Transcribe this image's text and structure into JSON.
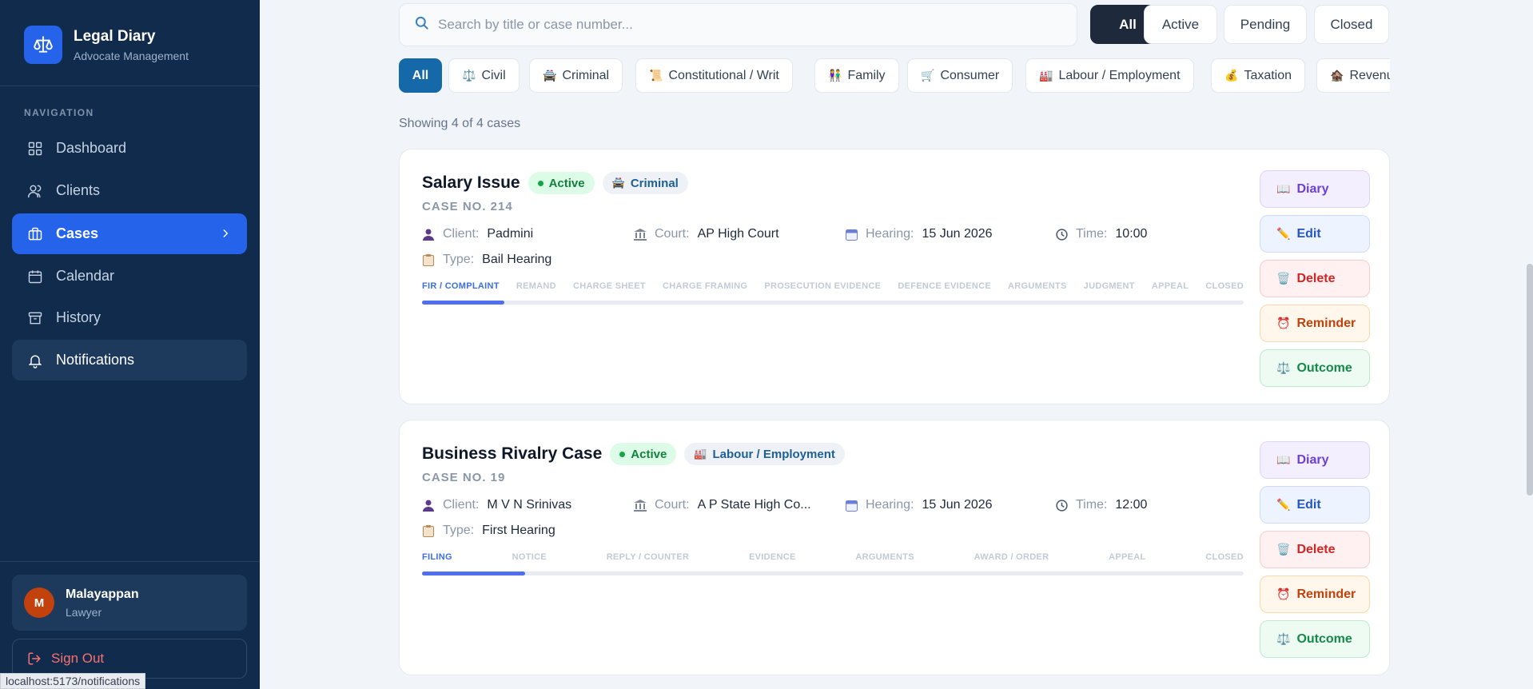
{
  "sidebar": {
    "brand_title": "Legal Diary",
    "brand_subtitle": "Advocate Management",
    "nav_heading": "NAVIGATION",
    "items": [
      {
        "label": "Dashboard",
        "icon": "dashboard-icon"
      },
      {
        "label": "Clients",
        "icon": "users-icon"
      },
      {
        "label": "Cases",
        "icon": "briefcase-icon",
        "active": true
      },
      {
        "label": "Calendar",
        "icon": "calendar-icon"
      },
      {
        "label": "History",
        "icon": "archive-icon"
      },
      {
        "label": "Notifications",
        "icon": "bell-icon",
        "hovered": true
      }
    ],
    "user": {
      "initial": "M",
      "name": "Malayappan",
      "role": "Lawyer"
    },
    "signout_label": "Sign Out",
    "status_url": "localhost:5173/notifications"
  },
  "search": {
    "placeholder": "Search by title or case number..."
  },
  "status_filters": [
    "All",
    "Active",
    "Pending",
    "Closed"
  ],
  "status_filter_selected": "All",
  "categories": [
    {
      "label": "All",
      "emoji": ""
    },
    {
      "label": "Civil",
      "emoji": "⚖️"
    },
    {
      "label": "Criminal",
      "emoji": "🚔"
    },
    {
      "label": "Constitutional / Writ",
      "emoji": "📜"
    },
    {
      "label": "Family",
      "emoji": "👫"
    },
    {
      "label": "Consumer",
      "emoji": "🛒"
    },
    {
      "label": "Labour / Employment",
      "emoji": "🏭"
    },
    {
      "label": "Taxation",
      "emoji": "💰"
    },
    {
      "label": "Revenu",
      "emoji": "🏚️"
    }
  ],
  "showing_text": "Showing 4 of 4 cases",
  "field_labels": {
    "client": "Client:",
    "court": "Court:",
    "hearing": "Hearing:",
    "time": "Time:",
    "type": "Type:"
  },
  "actions": {
    "diary": "Diary",
    "edit": "Edit",
    "delete": "Delete",
    "reminder": "Reminder",
    "outcome": "Outcome"
  },
  "cases": [
    {
      "title": "Salary Issue",
      "status": "Active",
      "category": "Criminal",
      "category_emoji": "🚔",
      "case_no": "CASE NO. 214",
      "client": "Padmini",
      "court": "AP High Court",
      "hearing": "15 Jun 2026",
      "time": "10:00",
      "type": "Bail Hearing",
      "stages": [
        "FIR / COMPLAINT",
        "REMAND",
        "CHARGE SHEET",
        "CHARGE FRAMING",
        "PROSECUTION EVIDENCE",
        "DEFENCE EVIDENCE",
        "ARGUMENTS",
        "JUDGMENT",
        "APPEAL",
        "CLOSED"
      ],
      "current_stage": 0,
      "progress": 0.1
    },
    {
      "title": "Business Rivalry Case",
      "status": "Active",
      "category": "Labour / Employment",
      "category_emoji": "🏭",
      "case_no": "CASE NO. 19",
      "client": "M V N Srinivas",
      "court": "A P State High Co...",
      "hearing": "15 Jun 2026",
      "time": "12:00",
      "type": "First Hearing",
      "stages": [
        "FILING",
        "NOTICE",
        "REPLY / COUNTER",
        "EVIDENCE",
        "ARGUMENTS",
        "AWARD / ORDER",
        "APPEAL",
        "CLOSED"
      ],
      "current_stage": 0,
      "progress": 0.125
    }
  ],
  "colors": {
    "sidebar_bg": "#112b4c",
    "accent": "#2563eb",
    "category_active": "#1569a8",
    "status_active": "#15803d"
  }
}
